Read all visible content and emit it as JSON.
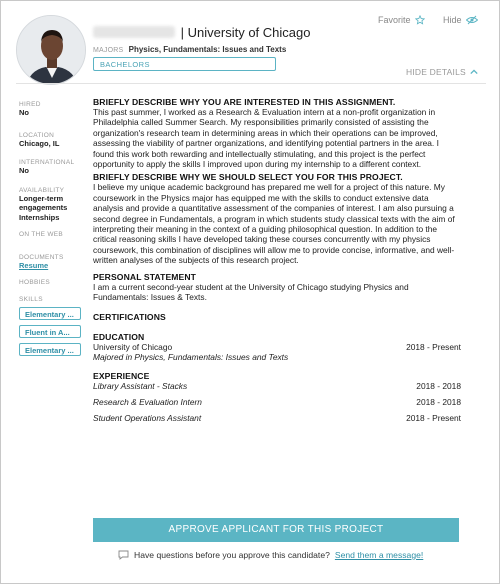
{
  "header": {
    "name": "",
    "separator": "|",
    "school": "University of Chicago",
    "majors_label": "MAJORS",
    "majors_value": "Physics, Fundamentals: Issues and Texts",
    "degree": "BACHELORS",
    "favorite_label": "Favorite",
    "hide_label": "Hide",
    "hide_details_label": "HIDE DETAILS"
  },
  "sidebar": {
    "hired_label": "HIRED",
    "hired_value": "No",
    "location_label": "LOCATION",
    "location_value": "Chicago, IL",
    "international_label": "INTERNATIONAL",
    "international_value": "No",
    "availability_label": "AVAILABILITY",
    "availability_lines": [
      "Longer-term",
      "engagements",
      "Internships"
    ],
    "web_label": "ON THE WEB",
    "documents_label": "DOCUMENTS",
    "resume_link": "Resume",
    "hobbies_label": "HOBBIES",
    "skills_label": "SKILLS",
    "skills": [
      "Elementary ...",
      "Fluent in A...",
      "Elementary ..."
    ]
  },
  "main": {
    "q1_heading": "BRIEFLY DESCRIBE WHY YOU ARE INTERESTED IN THIS ASSIGNMENT.",
    "q1_answer": "This past summer, I worked as a Research & Evaluation intern at a non-profit organization in Philadelphia called Summer Search. My responsibilities primarily consisted of assisting the organization's research team in determining areas in which their operations can be improved, assessing the viability of partner organizations, and identifying potential partners in the area. I found this work both rewarding and intellectually stimulating, and this project is the perfect opportunity to apply the skills I improved upon during my internship to a different context.",
    "q2_heading": "BRIEFLY DESCRIBE WHY WE SHOULD SELECT YOU FOR THIS PROJECT.",
    "q2_answer": "I believe my unique academic background has prepared me well for a project of this nature. My coursework in the Physics major has equipped me with the skills to conduct extensive data analysis and provide a quantitative assessment of the companies of interest. I am also pursuing a second degree in Fundamentals, a program in which students study classical texts with the aim of interpreting their meaning in the context of a guiding philosophical question. In addition to the critical reasoning skills I have developed taking these courses concurrently with my physics coursework, this combination of disciplines will allow me to provide concise, informative, and well-written analyses of the subjects of this research project.",
    "statement_heading": "PERSONAL STATEMENT",
    "statement_text": "I am a current second-year student at the University of Chicago studying Physics and Fundamentals: Issues & Texts.",
    "certifications_heading": "CERTIFICATIONS",
    "education_heading": "EDUCATION",
    "education": {
      "school": "University of Chicago",
      "dates": "2018 - Present",
      "detail": "Majored in Physics, Fundamentals: Issues and Texts"
    },
    "experience_heading": "EXPERIENCE",
    "experience": [
      {
        "title": "Library Assistant - Stacks",
        "dates": "2018 - 2018"
      },
      {
        "title": "Research & Evaluation Intern",
        "dates": "2018 - 2018"
      },
      {
        "title": "Student Operations Assistant",
        "dates": "2018 - Present"
      }
    ]
  },
  "footer": {
    "approve_label": "APPROVE APPLICANT FOR THIS PROJECT",
    "question_text": "Have questions before you approve this candidate?",
    "message_link": "Send them a message!"
  },
  "colors": {
    "accent": "#5bb5c4",
    "link": "#2f8fa6"
  },
  "icons": [
    "star-icon",
    "eye-slash-icon",
    "chevron-up-icon",
    "chat-bubble-icon"
  ]
}
